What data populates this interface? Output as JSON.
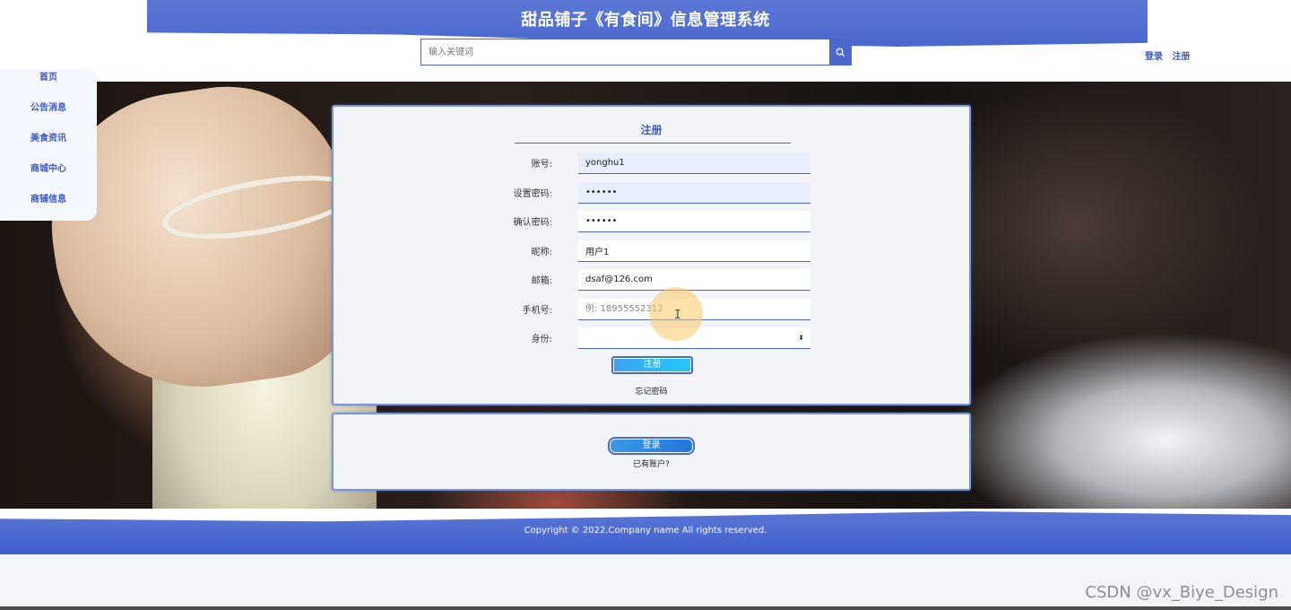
{
  "header": {
    "title": "甜品铺子《有食间》信息管理系统",
    "search_placeholder": "输入关键词",
    "login_link": "登录",
    "register_link": "注册"
  },
  "side_nav": {
    "items": [
      {
        "label": "首页"
      },
      {
        "label": "公告消息"
      },
      {
        "label": "美食资讯"
      },
      {
        "label": "商城中心"
      },
      {
        "label": "商铺信息"
      }
    ]
  },
  "register_form": {
    "title": "注册",
    "fields": [
      {
        "label": "账号:",
        "value": "yonghu1",
        "placeholder": ""
      },
      {
        "label": "设置密码:",
        "value": "••••••",
        "placeholder": ""
      },
      {
        "label": "确认密码:",
        "value": "••••••",
        "placeholder": ""
      },
      {
        "label": "昵称:",
        "value": "用户1",
        "placeholder": ""
      },
      {
        "label": "邮箱:",
        "value": "dsaf@126.com",
        "placeholder": ""
      },
      {
        "label": "手机号:",
        "value": "",
        "placeholder": "例: 18955552312"
      }
    ],
    "identity_label": "身份:",
    "identity_value": "",
    "submit_label": "注册",
    "forgot_label": "忘记密码"
  },
  "login_box": {
    "button_label": "登录",
    "hint": "已有账户?"
  },
  "footer": {
    "copyright": "Copyright © 2022.Company name All rights reserved."
  },
  "watermark": "CSDN @vx_Biye_Design",
  "colors": {
    "brand_blue": "#4a68cf",
    "button_gradient_start": "#3fa2f2",
    "button_gradient_end": "#20c8f6"
  }
}
